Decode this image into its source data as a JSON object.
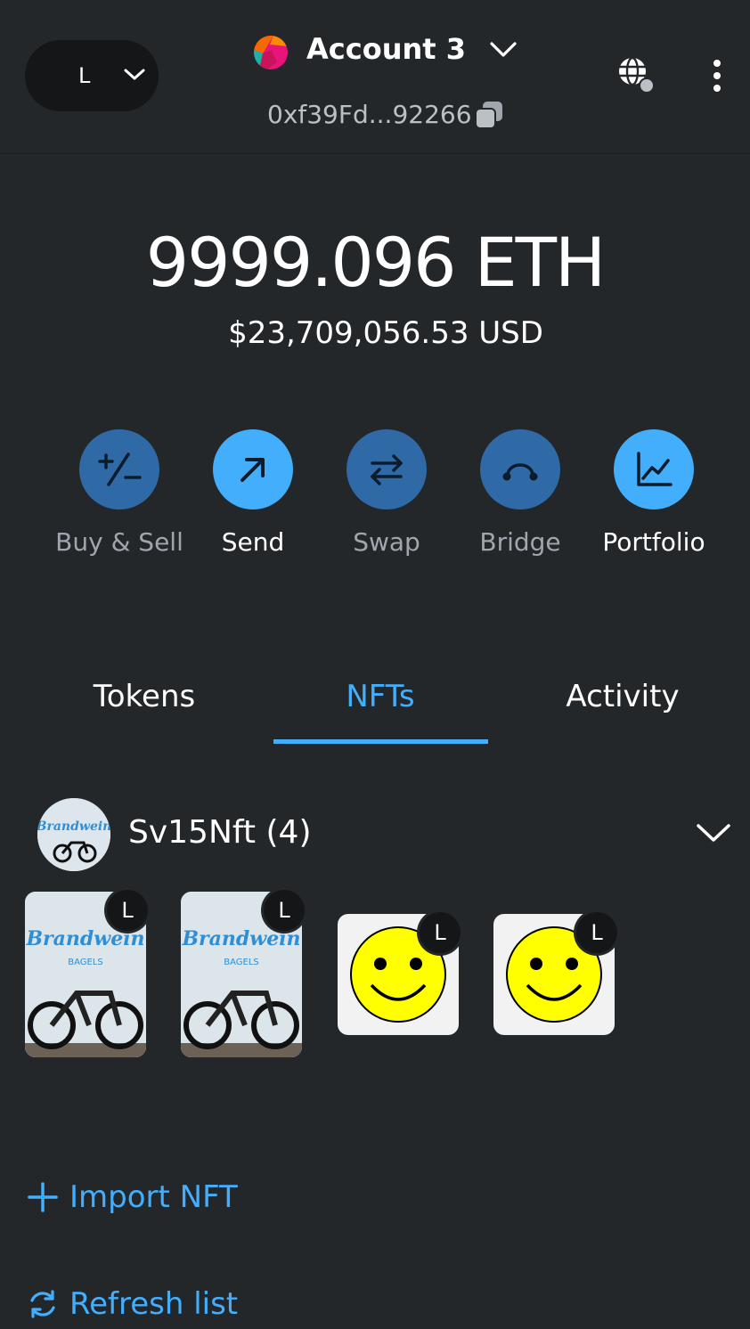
{
  "header": {
    "network_letter": "L",
    "account_name": "Account 3",
    "address": "0xf39Fd...92266"
  },
  "balance": {
    "primary": "9999.096 ETH",
    "fiat": "$23,709,056.53 USD"
  },
  "actions": [
    {
      "label": "Buy & Sell",
      "icon": "buy-sell-icon"
    },
    {
      "label": "Send",
      "icon": "arrow-up-right-icon"
    },
    {
      "label": "Swap",
      "icon": "swap-arrows-icon"
    },
    {
      "label": "Bridge",
      "icon": "bridge-icon"
    },
    {
      "label": "Portfolio",
      "icon": "chart-line-icon"
    }
  ],
  "tabs": [
    {
      "label": "Tokens"
    },
    {
      "label": "NFTs",
      "active": true
    },
    {
      "label": "Activity"
    }
  ],
  "collection": {
    "title": "Sv15Nft (4)",
    "network_badge": "L"
  },
  "links": {
    "import_nft": "Import NFT",
    "refresh_list": "Refresh list"
  },
  "colors": {
    "background": "#24272a",
    "accent": "#43aefc",
    "accent_dim": "#2f6aa6",
    "muted_text": "#9fa6ae"
  }
}
